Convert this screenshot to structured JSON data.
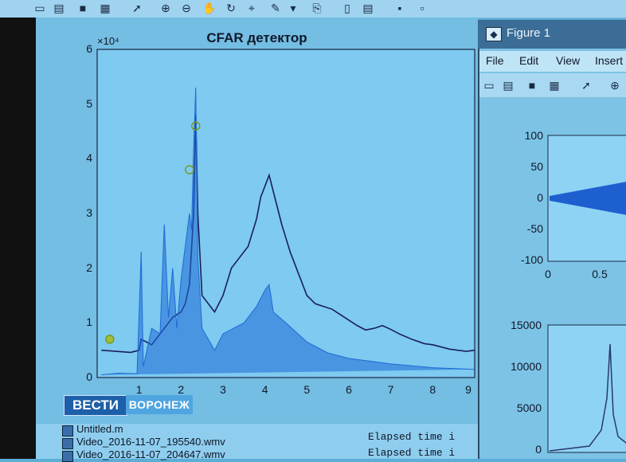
{
  "main_figure": {
    "title": "CFAR детектор",
    "y_exponent": "×10⁴",
    "y_ticks": [
      "6",
      "5",
      "4",
      "3",
      "2",
      "1",
      "0"
    ],
    "x_ticks": [
      "1",
      "2",
      "3",
      "4",
      "5",
      "6",
      "7",
      "8",
      "9"
    ]
  },
  "chart_data": [
    {
      "type": "line",
      "title": "CFAR детектор",
      "xlim": [
        0,
        9
      ],
      "ylim": [
        0,
        60000
      ],
      "series": [
        {
          "role": "threshold",
          "color": "#1a1f5a",
          "x": [
            0.1,
            0.8,
            1.0,
            1.05,
            1.3,
            1.6,
            1.8,
            2.0,
            2.1,
            2.2,
            2.3,
            2.35,
            2.4,
            2.5,
            2.8,
            3.0,
            3.2,
            3.4,
            3.6,
            3.8,
            3.9,
            4.0,
            4.1,
            4.2,
            4.3,
            4.4,
            4.6,
            4.8,
            5.0,
            5.2,
            5.4,
            5.6,
            5.8,
            6.0,
            6.2,
            6.4,
            6.6,
            6.8,
            7.0,
            7.2,
            7.5,
            7.8,
            8.0,
            8.4,
            8.8,
            9.0
          ],
          "y": [
            5000,
            4600,
            5000,
            7000,
            6000,
            9000,
            11000,
            12000,
            13500,
            17000,
            30000,
            48000,
            30000,
            15000,
            12000,
            15000,
            20000,
            22000,
            24000,
            29000,
            33000,
            35000,
            37000,
            34000,
            31000,
            28000,
            23000,
            19000,
            15000,
            13500,
            13000,
            12500,
            11500,
            10500,
            9500,
            8700,
            9000,
            9500,
            8800,
            8000,
            7000,
            6200,
            6000,
            5200,
            4800,
            5000
          ]
        },
        {
          "role": "signal",
          "color": "#1e6ad6",
          "x": [
            0.1,
            0.5,
            0.95,
            1.05,
            1.1,
            1.3,
            1.5,
            1.6,
            1.7,
            1.8,
            1.9,
            2.0,
            2.1,
            2.2,
            2.25,
            2.3,
            2.35,
            2.4,
            2.5,
            2.8,
            3.0,
            3.5,
            3.8,
            4.0,
            4.1,
            4.2,
            4.5,
            5.0,
            5.5,
            6.0,
            6.5,
            7.0,
            8.0,
            9.0
          ],
          "y": [
            500,
            800,
            700,
            23000,
            2000,
            9000,
            8000,
            28000,
            11000,
            20000,
            9000,
            18000,
            24000,
            30000,
            27000,
            42000,
            53000,
            22000,
            9000,
            5000,
            8000,
            10000,
            13000,
            16000,
            17000,
            12000,
            10000,
            6500,
            4500,
            3500,
            3000,
            2500,
            1800,
            1500
          ]
        }
      ],
      "detections": [
        0.3,
        2.2,
        2.35
      ]
    },
    {
      "type": "line",
      "ylim": [
        -100,
        100
      ],
      "xlim": [
        0,
        1
      ],
      "x_ticks": [
        "0",
        "0.5"
      ],
      "y_ticks": [
        "100",
        "50",
        "0",
        "-50",
        "-100"
      ]
    },
    {
      "type": "line",
      "ylim": [
        0,
        15000
      ],
      "y_ticks": [
        "15000",
        "10000",
        "5000",
        "0"
      ]
    }
  ],
  "figure_window": {
    "title": "Figure 1",
    "menu": [
      "File",
      "Edit",
      "View",
      "Insert"
    ]
  },
  "files": [
    "Untitled.m",
    "Video_2016-11-07_195540.wmv",
    "Video_2016-11-07_204647.wmv"
  ],
  "console": [
    "Elapsed time i",
    "Elapsed time i"
  ],
  "logo": {
    "brand": "ВЕСТИ",
    "city": "ВОРОНЕЖ"
  }
}
